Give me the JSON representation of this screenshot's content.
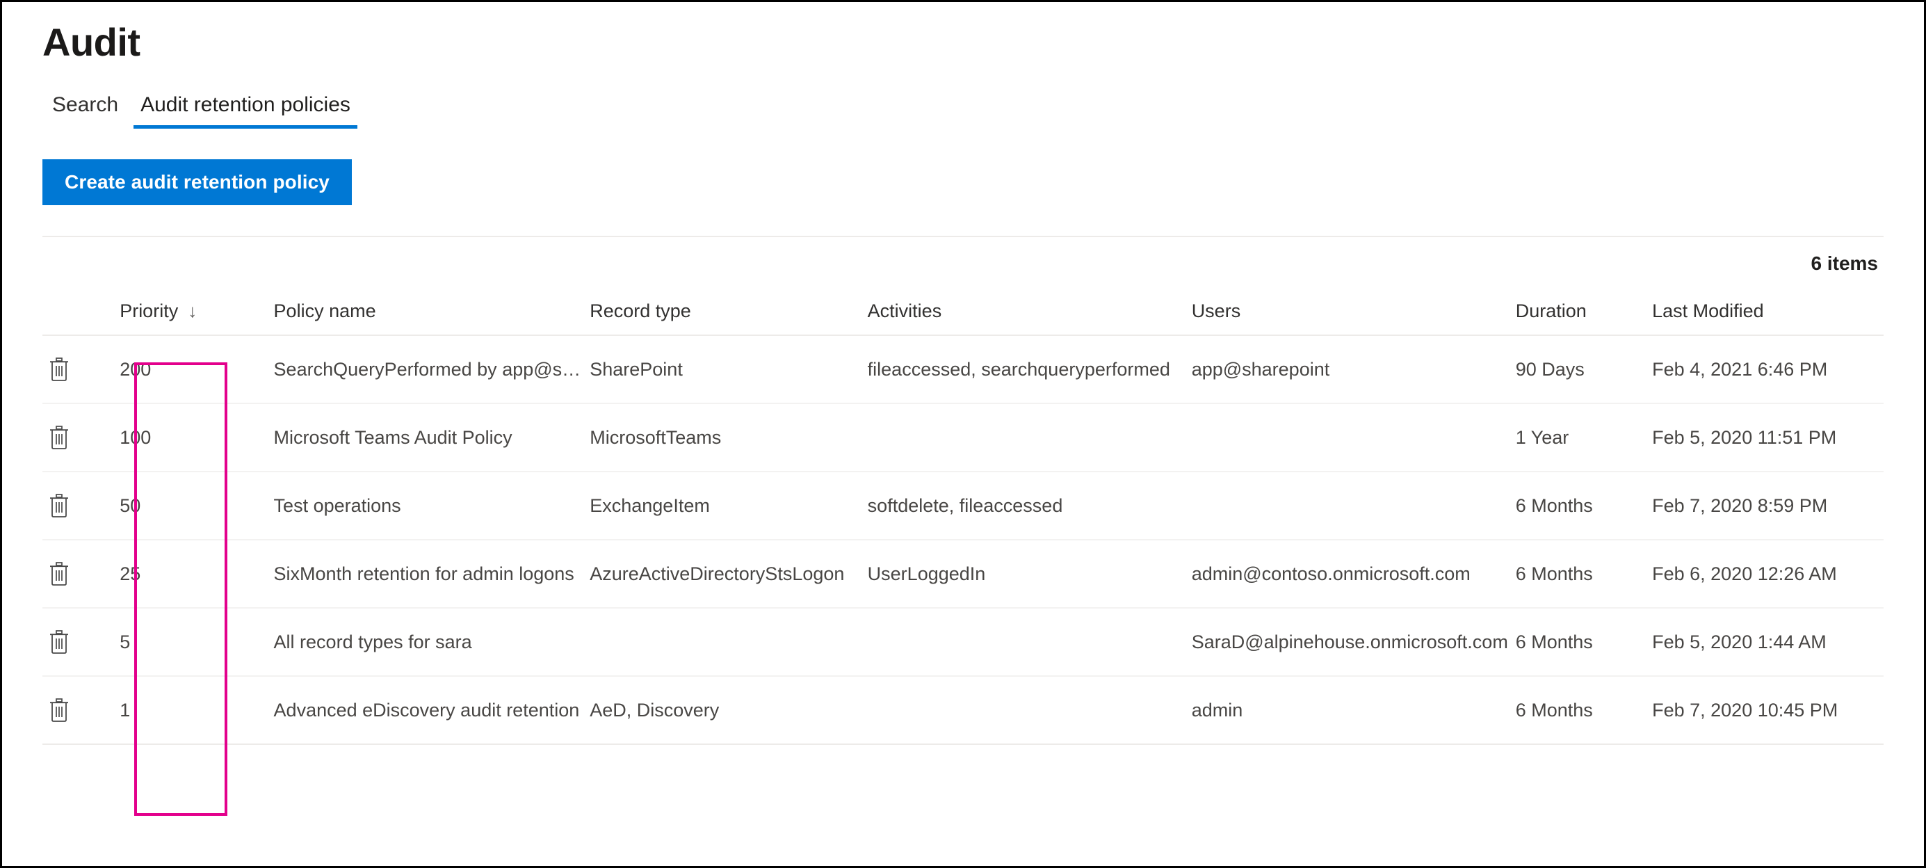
{
  "page": {
    "title": "Audit"
  },
  "tabs": [
    {
      "label": "Search",
      "selected": false
    },
    {
      "label": "Audit retention policies",
      "selected": true
    }
  ],
  "toolbar": {
    "create_label": "Create audit retention policy"
  },
  "list": {
    "item_count": "6 items",
    "sort_indicator": "↓",
    "delete_icon": "trash-icon",
    "columns": [
      "Priority",
      "Policy name",
      "Record type",
      "Activities",
      "Users",
      "Duration",
      "Last Modified"
    ],
    "rows": [
      {
        "priority": "200",
        "policy_name": "SearchQueryPerformed by app@share…",
        "record_type": "SharePoint",
        "activities": "fileaccessed, searchqueryperformed",
        "users": "app@sharepoint",
        "duration": "90 Days",
        "last_modified": "Feb 4, 2021 6:46 PM"
      },
      {
        "priority": "100",
        "policy_name": "Microsoft Teams Audit Policy",
        "record_type": "MicrosoftTeams",
        "activities": "",
        "users": "",
        "duration": "1 Year",
        "last_modified": "Feb 5, 2020 11:51 PM"
      },
      {
        "priority": "50",
        "policy_name": "Test operations",
        "record_type": "ExchangeItem",
        "activities": "softdelete, fileaccessed",
        "users": "",
        "duration": "6 Months",
        "last_modified": "Feb 7, 2020 8:59 PM"
      },
      {
        "priority": "25",
        "policy_name": "SixMonth retention for admin logons",
        "record_type": "AzureActiveDirectoryStsLogon",
        "activities": "UserLoggedIn",
        "users": "admin@contoso.onmicrosoft.com",
        "duration": "6 Months",
        "last_modified": "Feb 6, 2020 12:26 AM"
      },
      {
        "priority": "5",
        "policy_name": "All record types for sara",
        "record_type": "",
        "activities": "",
        "users": "SaraD@alpinehouse.onmicrosoft.com",
        "duration": "6 Months",
        "last_modified": "Feb 5, 2020 1:44 AM"
      },
      {
        "priority": "1",
        "policy_name": "Advanced eDiscovery audit retention",
        "record_type": "AeD, Discovery",
        "activities": "",
        "users": "admin",
        "duration": "6 Months",
        "last_modified": "Feb 7, 2020 10:45 PM"
      }
    ]
  },
  "annotation": {
    "name": "priority-column-highlight",
    "color": "#e3008c"
  },
  "colors": {
    "accent": "#0078d4",
    "highlight": "#e3008c",
    "text_primary": "#201f1e",
    "text_secondary": "#484644",
    "row_divider": "#f3f2f1"
  }
}
